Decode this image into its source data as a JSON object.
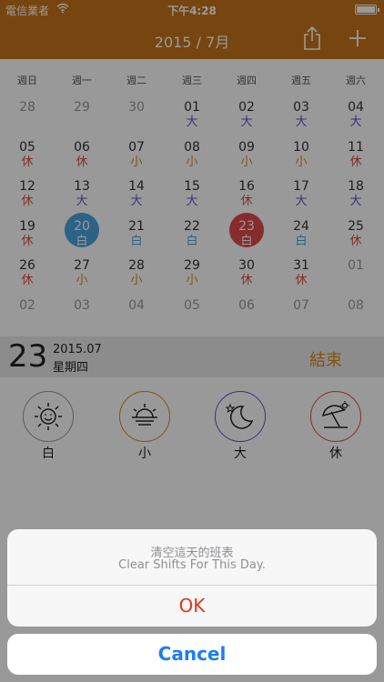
{
  "status": {
    "carrier": "電信業者",
    "time": "下午4:28"
  },
  "nav": {
    "title": "2015 / 7月",
    "share_icon": "share-icon",
    "add_icon": "plus-icon"
  },
  "week_headers": [
    "週日",
    "週一",
    "週二",
    "週三",
    "週四",
    "週五",
    "週六"
  ],
  "calendar_rows": [
    [
      {
        "day": "28",
        "shift": "",
        "dim": true
      },
      {
        "day": "29",
        "shift": "",
        "dim": true
      },
      {
        "day": "30",
        "shift": "",
        "dim": true
      },
      {
        "day": "01",
        "shift": "大"
      },
      {
        "day": "02",
        "shift": "大"
      },
      {
        "day": "03",
        "shift": "大"
      },
      {
        "day": "04",
        "shift": "大"
      }
    ],
    [
      {
        "day": "05",
        "shift": "休"
      },
      {
        "day": "06",
        "shift": "休"
      },
      {
        "day": "07",
        "shift": "小"
      },
      {
        "day": "08",
        "shift": "小"
      },
      {
        "day": "09",
        "shift": "小"
      },
      {
        "day": "10",
        "shift": "小"
      },
      {
        "day": "11",
        "shift": "休"
      }
    ],
    [
      {
        "day": "12",
        "shift": "休"
      },
      {
        "day": "13",
        "shift": "大"
      },
      {
        "day": "14",
        "shift": "大"
      },
      {
        "day": "15",
        "shift": "大"
      },
      {
        "day": "16",
        "shift": "休"
      },
      {
        "day": "17",
        "shift": "大"
      },
      {
        "day": "18",
        "shift": "大"
      }
    ],
    [
      {
        "day": "19",
        "shift": "休"
      },
      {
        "day": "20",
        "shift": "白",
        "sel": "blue"
      },
      {
        "day": "21",
        "shift": "白"
      },
      {
        "day": "22",
        "shift": "白"
      },
      {
        "day": "23",
        "shift": "白",
        "sel": "red"
      },
      {
        "day": "24",
        "shift": "白"
      },
      {
        "day": "25",
        "shift": "休"
      }
    ],
    [
      {
        "day": "26",
        "shift": "休"
      },
      {
        "day": "27",
        "shift": "小"
      },
      {
        "day": "28",
        "shift": "小"
      },
      {
        "day": "29",
        "shift": "小"
      },
      {
        "day": "30",
        "shift": "休"
      },
      {
        "day": "31",
        "shift": "休"
      },
      {
        "day": "01",
        "shift": "",
        "dim": true
      }
    ],
    [
      {
        "day": "02",
        "shift": "",
        "dim": true
      },
      {
        "day": "03",
        "shift": "",
        "dim": true
      },
      {
        "day": "04",
        "shift": "",
        "dim": true
      },
      {
        "day": "05",
        "shift": "",
        "dim": true
      },
      {
        "day": "06",
        "shift": "",
        "dim": true
      },
      {
        "day": "07",
        "shift": "",
        "dim": true
      },
      {
        "day": "08",
        "shift": "",
        "dim": true
      }
    ]
  ],
  "selected_day": {
    "num": "23",
    "date": "2015.07",
    "weekday": "星期四",
    "end_label": "結束"
  },
  "shift_buttons": [
    {
      "label": "白",
      "icon": "sun-face-icon",
      "color": "#9a9a9a"
    },
    {
      "label": "小",
      "icon": "sunset-icon",
      "color": "#d68b1b"
    },
    {
      "label": "大",
      "icon": "moon-star-icon",
      "color": "#5a57c9"
    },
    {
      "label": "休",
      "icon": "beach-umbrella-icon",
      "color": "#d9533c"
    }
  ],
  "action_sheet": {
    "message_zh": "清空這天的班表",
    "message_en": "Clear Shifts For This Day.",
    "ok_label": "OK",
    "cancel_label": "Cancel",
    "ok_color": "#e0361b",
    "cancel_color": "#1f7cf5"
  },
  "colors": {
    "accent": "#c7741a",
    "大": "#5a57c9",
    "休": "#d9533c",
    "小": "#d68b1b",
    "白": "#4aa3df"
  }
}
